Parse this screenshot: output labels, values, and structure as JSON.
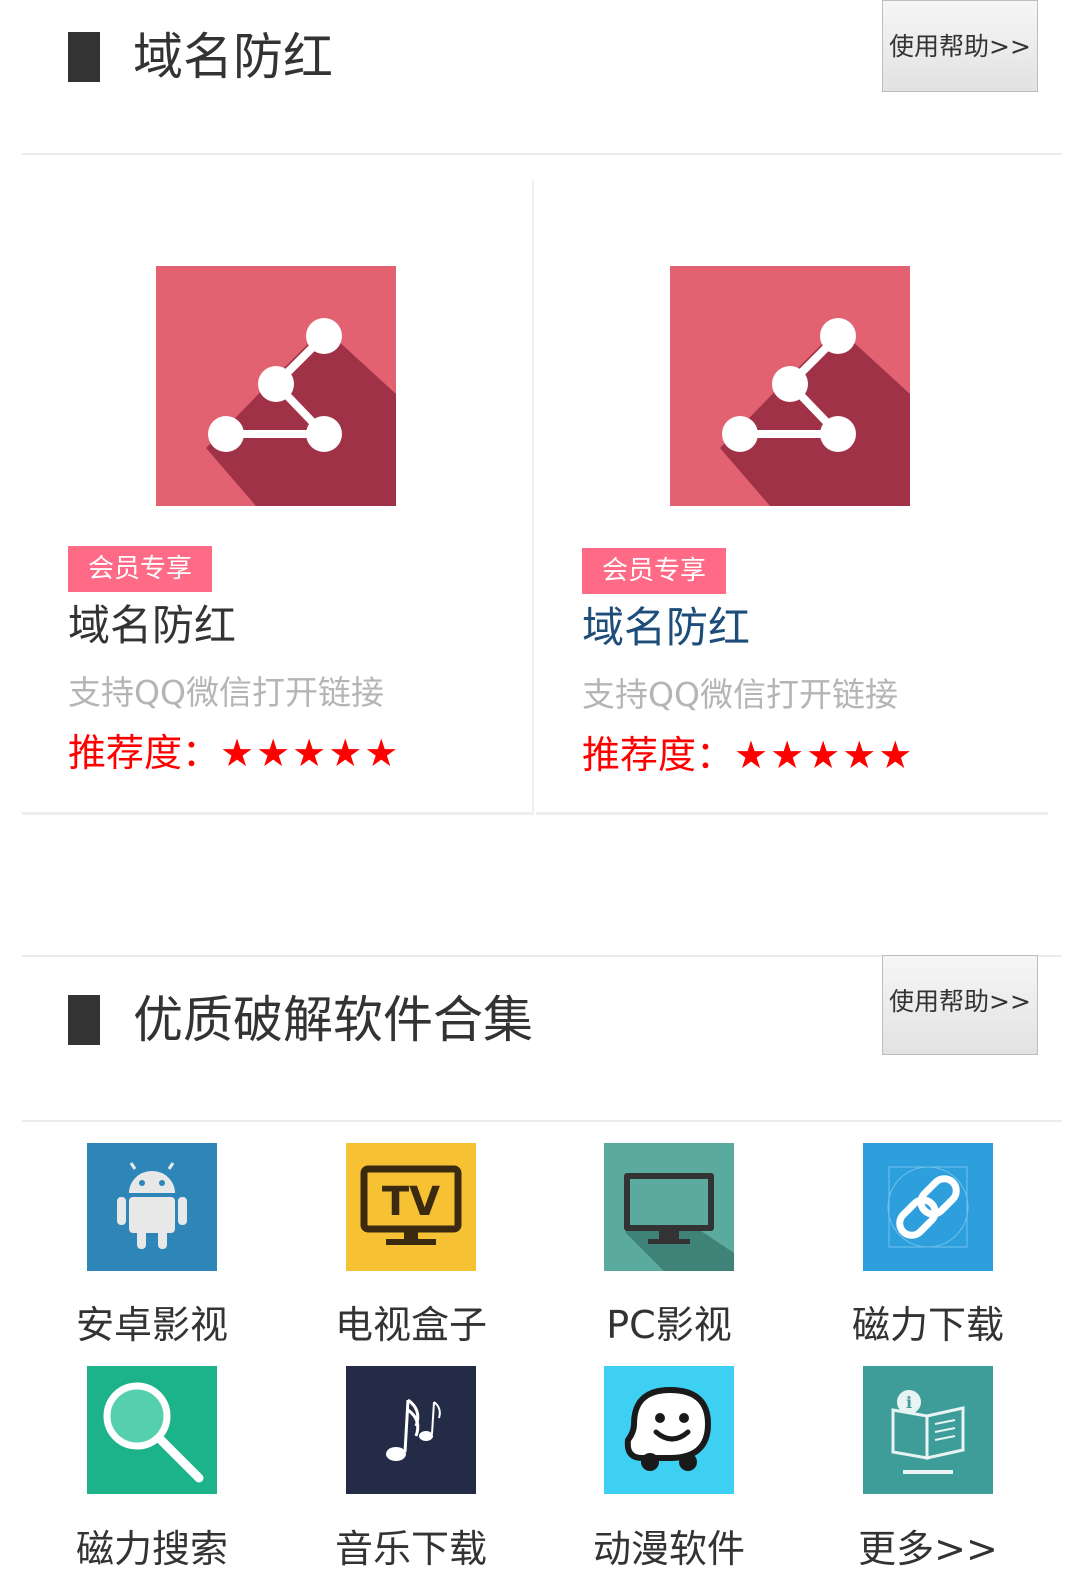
{
  "section1": {
    "title": "域名防红",
    "help_label": "使用帮助>>"
  },
  "cards": [
    {
      "badge": "会员专享",
      "title": "域名防红",
      "desc": "支持QQ微信打开链接",
      "rating_label": "推荐度：",
      "stars": "★★★★★",
      "title_color": "#333333",
      "icon_bg": "#e26272",
      "icon_shadow": "#a03248"
    },
    {
      "badge": "会员专享",
      "title": "域名防红",
      "desc": "支持QQ微信打开链接",
      "rating_label": "推荐度：",
      "stars": "★★★★★",
      "title_color": "#1e4d7a",
      "icon_bg": "#e26272",
      "icon_shadow": "#a03248"
    }
  ],
  "section2": {
    "title": "优质破解软件合集",
    "help_label": "使用帮助>>"
  },
  "grid": [
    {
      "label": "安卓影视",
      "icon": "android-icon",
      "bg": "#2e86b8"
    },
    {
      "label": "电视盒子",
      "icon": "tv-icon",
      "bg": "#f7c134"
    },
    {
      "label": "PC影视",
      "icon": "monitor-icon",
      "bg": "#5aab9e"
    },
    {
      "label": "磁力下载",
      "icon": "link-icon",
      "bg": "#2d9fdd"
    },
    {
      "label": "磁力搜索",
      "icon": "search-icon",
      "bg": "#1db38a"
    },
    {
      "label": "音乐下载",
      "icon": "music-note-icon",
      "bg": "#232b46"
    },
    {
      "label": "动漫软件",
      "icon": "waze-smile-icon",
      "bg": "#3dd0f3"
    },
    {
      "label": "更多>>",
      "icon": "book-info-icon",
      "bg": "#3e9d99"
    }
  ]
}
